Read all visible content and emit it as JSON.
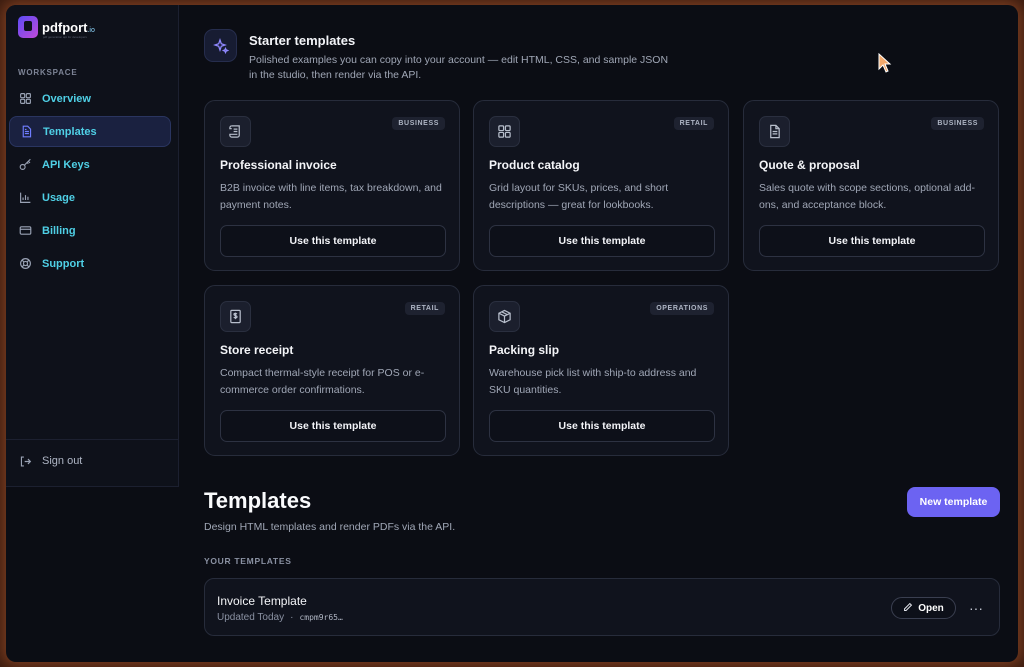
{
  "app": {
    "logo_name": "pdfport",
    "logo_suffix": ".io",
    "logo_tagline": "pdf generation api for developers"
  },
  "sidebar": {
    "section_label": "WORKSPACE",
    "items": [
      {
        "label": "Overview",
        "icon": "grid-icon"
      },
      {
        "label": "Templates",
        "icon": "document-icon",
        "active": true
      },
      {
        "label": "API Keys",
        "icon": "key-icon"
      },
      {
        "label": "Usage",
        "icon": "bar-chart-icon"
      },
      {
        "label": "Billing",
        "icon": "credit-card-icon"
      },
      {
        "label": "Support",
        "icon": "lifebuoy-icon"
      }
    ],
    "signout_label": "Sign out"
  },
  "starter": {
    "title": "Starter templates",
    "subtitle": "Polished examples you can copy into your account — edit HTML, CSS, and sample JSON in the studio, then render via the API.",
    "cards": [
      {
        "badge": "BUSINESS",
        "title": "Professional invoice",
        "desc": "B2B invoice with line items, tax breakdown, and payment notes.",
        "button": "Use this template",
        "icon": "scroll-icon"
      },
      {
        "badge": "RETAIL",
        "title": "Product catalog",
        "desc": "Grid layout for SKUs, prices, and short descriptions — great for lookbooks.",
        "button": "Use this template",
        "icon": "grid-icon"
      },
      {
        "badge": "BUSINESS",
        "title": "Quote & proposal",
        "desc": "Sales quote with scope sections, optional add-ons, and acceptance block.",
        "button": "Use this template",
        "icon": "file-text-icon"
      },
      {
        "badge": "RETAIL",
        "title": "Store receipt",
        "desc": "Compact thermal-style receipt for POS or e-commerce order confirmations.",
        "button": "Use this template",
        "icon": "receipt-icon"
      },
      {
        "badge": "OPERATIONS",
        "title": "Packing slip",
        "desc": "Warehouse pick list with ship-to address and SKU quantities.",
        "button": "Use this template",
        "icon": "package-icon"
      }
    ]
  },
  "templates": {
    "title": "Templates",
    "subtitle": "Design HTML templates and render PDFs via the API.",
    "new_button": "New template",
    "section_label": "YOUR TEMPLATES",
    "rows": [
      {
        "name": "Invoice Template",
        "updated": "Updated Today",
        "separator": "·",
        "id": "cmpm9r65…",
        "open_label": "Open",
        "more": "···"
      }
    ]
  },
  "colors": {
    "accent": "#6c63f2",
    "nav_text": "#4fd0e6",
    "background": "#0b0d14"
  }
}
